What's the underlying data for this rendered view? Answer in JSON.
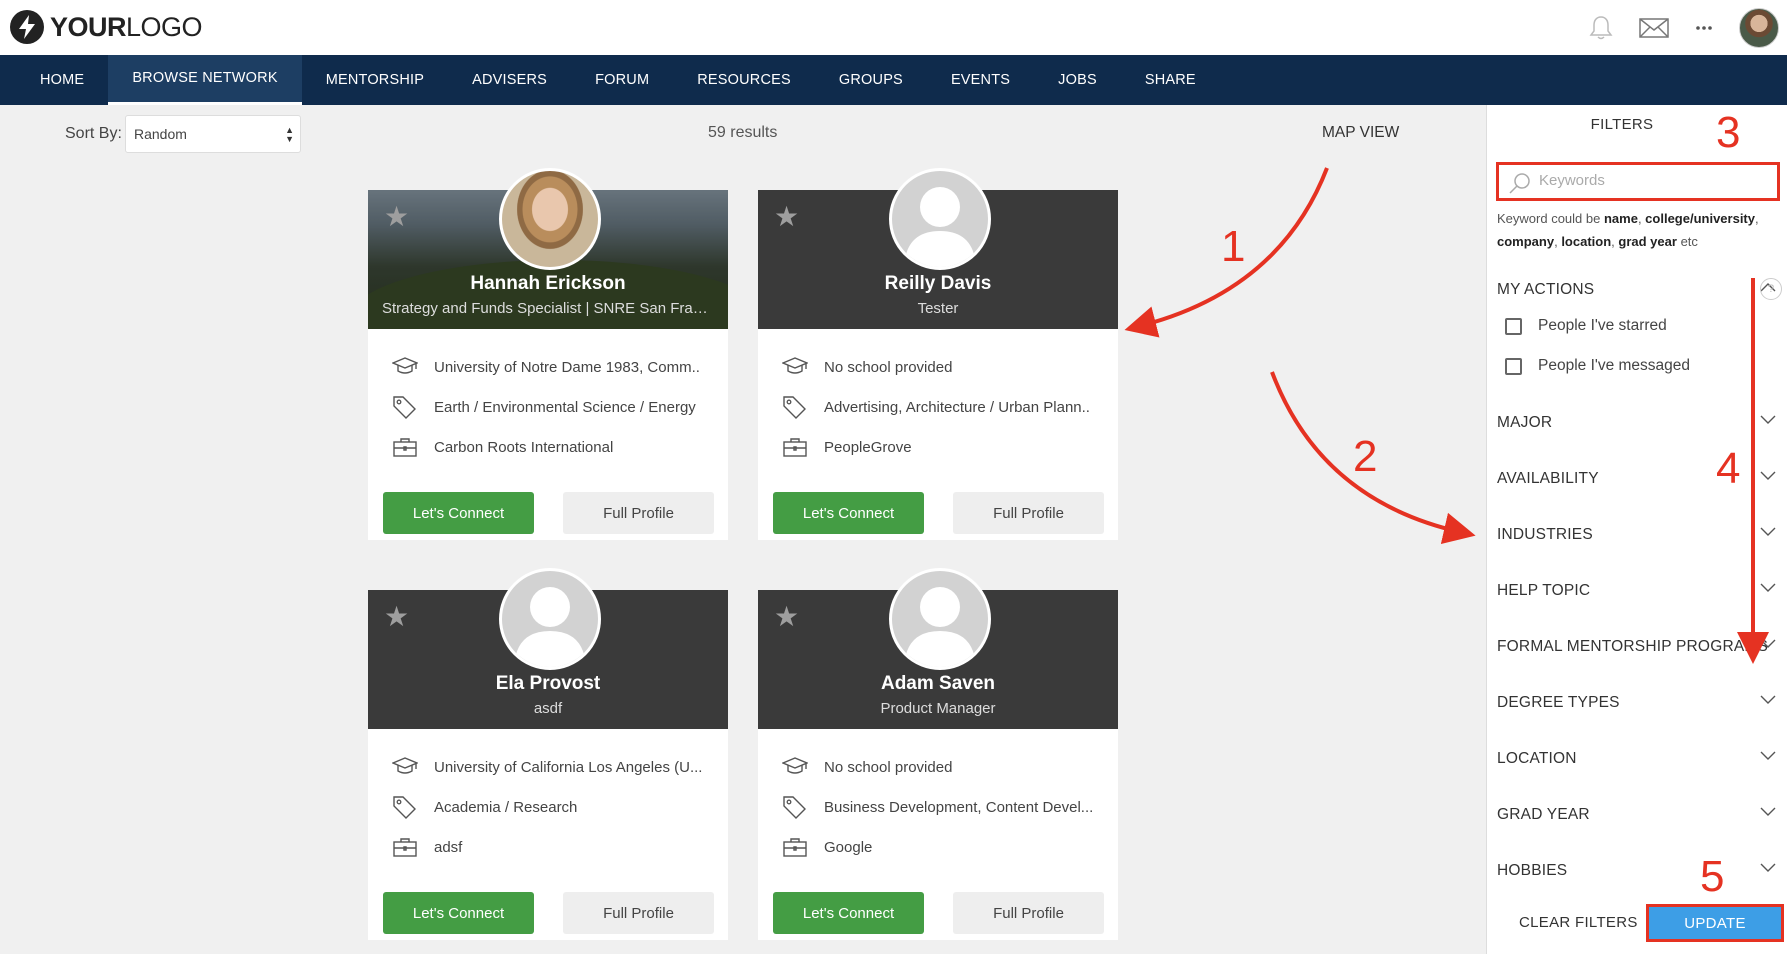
{
  "brand": {
    "logo_bold": "YOUR",
    "logo_light": "LOGO"
  },
  "nav": {
    "items": [
      {
        "label": "HOME"
      },
      {
        "label": "BROWSE NETWORK"
      },
      {
        "label": "MENTORSHIP"
      },
      {
        "label": "ADVISERS"
      },
      {
        "label": "FORUM"
      },
      {
        "label": "RESOURCES"
      },
      {
        "label": "GROUPS"
      },
      {
        "label": "EVENTS"
      },
      {
        "label": "JOBS"
      },
      {
        "label": "SHARE"
      }
    ],
    "active": "BROWSE NETWORK"
  },
  "toolbar": {
    "sort_label": "Sort By:",
    "sort_value": "Random",
    "results": "59 results",
    "map_view": "MAP VIEW"
  },
  "cards": [
    {
      "name": "Hannah Erickson",
      "role": "Strategy and Funds Specialist | SNRE San Francisco",
      "school": "University of Notre Dame 1983, Comm..",
      "interests": "Earth / Environmental Science / Energy",
      "company": "Carbon Roots International",
      "connect": "Let's Connect",
      "profile": "Full Profile"
    },
    {
      "name": "Reilly Davis",
      "role": "Tester",
      "school": "No school provided",
      "interests": "Advertising, Architecture / Urban Plann..",
      "company": "PeopleGrove",
      "connect": "Let's Connect",
      "profile": "Full Profile"
    },
    {
      "name": "Ela Provost",
      "role": "asdf",
      "school": "University of California Los Angeles (U...",
      "interests": "Academia / Research",
      "company": "adsf",
      "connect": "Let's Connect",
      "profile": "Full Profile"
    },
    {
      "name": "Adam Saven",
      "role": "Product Manager",
      "school": "No school provided",
      "interests": "Business Development, Content Devel...",
      "company": "Google",
      "connect": "Let's Connect",
      "profile": "Full Profile"
    }
  ],
  "filters": {
    "title": "FILTERS",
    "keywords_placeholder": "Keywords",
    "help": {
      "prefix": "Keyword could be",
      "t1": "name",
      "t2": "college/university",
      "t3": "company",
      "t4": "location",
      "t5": "grad year",
      "suffix": "etc"
    },
    "my_actions": "MY ACTIONS",
    "checkboxes": [
      "People I've starred",
      "People I've messaged"
    ],
    "help_glyph": "?",
    "sections": [
      "MAJOR",
      "AVAILABILITY",
      "INDUSTRIES",
      "HELP TOPIC",
      "FORMAL MENTORSHIP PROGRAMS",
      "DEGREE TYPES",
      "LOCATION",
      "GRAD YEAR",
      "HOBBIES"
    ],
    "clear": "CLEAR FILTERS",
    "update": "UPDATE"
  },
  "annotations": [
    "1",
    "2",
    "3",
    "4",
    "5"
  ],
  "colors": {
    "nav_bg": "#0f2b4c",
    "connect_green": "#449d44",
    "update_blue": "#3d9ee6",
    "annotation_red": "#e53222"
  }
}
